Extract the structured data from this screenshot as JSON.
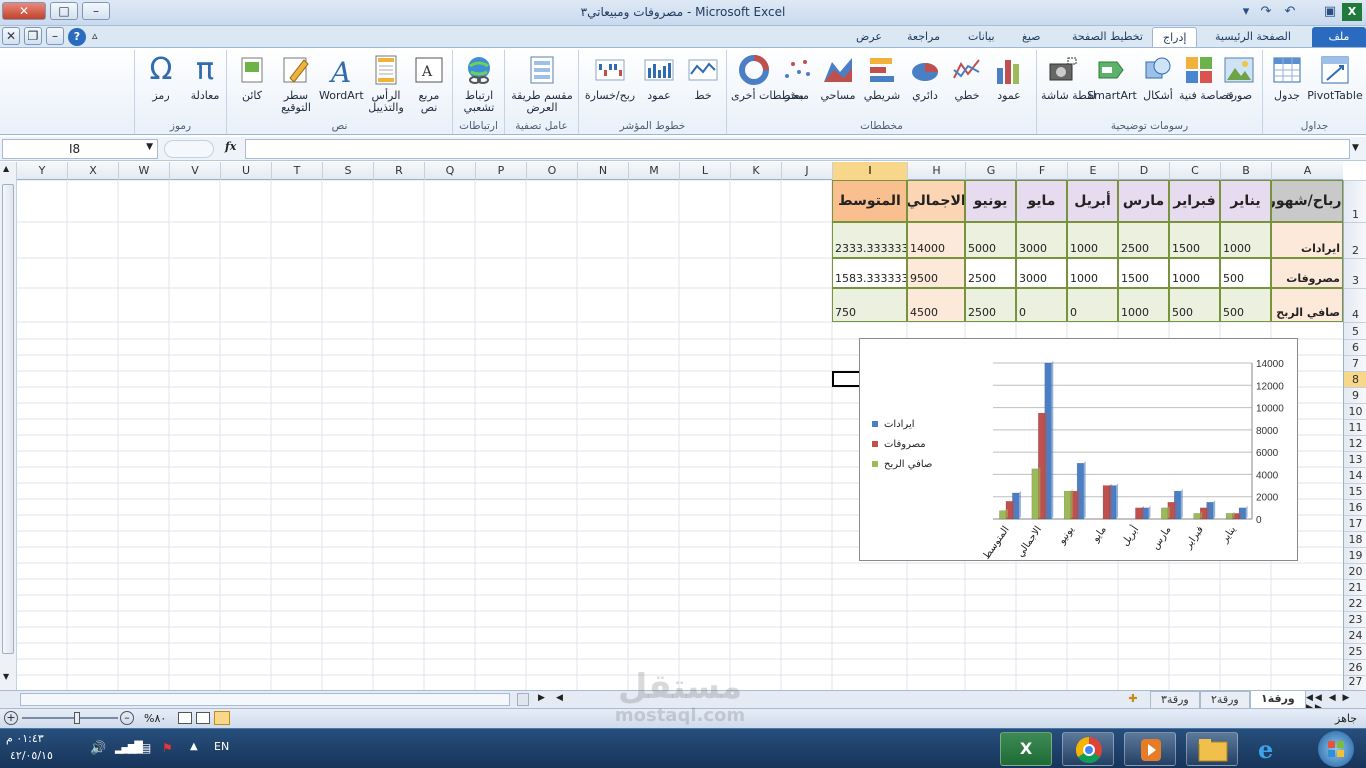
{
  "window": {
    "title": "مصروفات ومبيعاتي٣ - Microsoft Excel"
  },
  "qat": {
    "save_icon": "save-icon",
    "undo_icon": "undo-icon",
    "redo_icon": "redo-icon",
    "dropdown_icon": "chevron-down-icon"
  },
  "tabs": [
    {
      "label": "ملف",
      "name": "tab-file"
    },
    {
      "label": "الصفحة الرئيسية",
      "name": "tab-home"
    },
    {
      "label": "إدراج",
      "name": "tab-insert"
    },
    {
      "label": "تخطيط الصفحة",
      "name": "tab-page-layout"
    },
    {
      "label": "صيغ",
      "name": "tab-formulas"
    },
    {
      "label": "بيانات",
      "name": "tab-data"
    },
    {
      "label": "مراجعة",
      "name": "tab-review"
    },
    {
      "label": "عرض",
      "name": "tab-view"
    }
  ],
  "ribbon": {
    "groups": {
      "tables": "جداول",
      "illustrations": "رسومات توضيحية",
      "charts": "مخططات",
      "sparklines": "خطوط المؤشر",
      "filter": "عامل تصفية",
      "links": "ارتباطات",
      "text": "نص",
      "symbols": "رموز"
    },
    "buttons": {
      "pivot": "PivotTable",
      "table": "جدول",
      "picture": "صورة",
      "clipart": "قصاصة فنية",
      "shapes": "أشكال",
      "smartart": "SmartArt",
      "screenshot": "لقطة شاشة",
      "column": "عمود",
      "line": "خطي",
      "pie": "دائري",
      "bar": "شريطي",
      "area": "مساحي",
      "scatter": "مبعثر",
      "other": "مخططات أخرى",
      "sp_line": "خط",
      "sp_column": "عمود",
      "sp_winloss": "ربح/خسارة",
      "slicer": "مقسم طريقة العرض",
      "hyperlink": "ارتباط تشعبي",
      "textbox": "مربع نص",
      "headerfooter": "الرأس والتذييل",
      "wordart": "WordArt",
      "signature": "سطر التوقيع",
      "object": "كائن",
      "equation": "معادلة",
      "symbol": "رمز"
    }
  },
  "formula_bar": {
    "name_box": "I8",
    "fx": "fx",
    "formula": ""
  },
  "columns": [
    "A",
    "B",
    "C",
    "D",
    "E",
    "F",
    "G",
    "H",
    "I",
    "J",
    "K",
    "L",
    "M",
    "N",
    "O",
    "P",
    "Q",
    "R",
    "S",
    "T",
    "U",
    "V",
    "W",
    "X",
    "Y"
  ],
  "rows": [
    "1",
    "2",
    "3",
    "4",
    "5",
    "6",
    "7",
    "8",
    "9",
    "10",
    "11",
    "12",
    "13",
    "14",
    "15",
    "16",
    "17",
    "18",
    "19",
    "20",
    "21",
    "22",
    "23",
    "24",
    "25",
    "26",
    "27"
  ],
  "selected": {
    "column": "I",
    "row": "8"
  },
  "table": {
    "header": [
      "ارباح/شهور",
      "يناير",
      "فبراير",
      "مارس",
      "أبريل",
      "مايو",
      "يونيو",
      "الاجمالي",
      "المتوسط"
    ],
    "body": [
      [
        "ايرادات",
        "1000",
        "1500",
        "2500",
        "1000",
        "3000",
        "5000",
        "14000",
        "2333.333333"
      ],
      [
        "مصروفات",
        "500",
        "1000",
        "1500",
        "1000",
        "3000",
        "2500",
        "9500",
        "1583.333333"
      ],
      [
        "صافي الربح",
        "500",
        "500",
        "1000",
        "0",
        "0",
        "2500",
        "4500",
        "750"
      ]
    ]
  },
  "chart_data": {
    "type": "bar",
    "categories": [
      "يناير",
      "فبراير",
      "مارس",
      "أبريل",
      "مايو",
      "يونيو",
      "الاجمالي",
      "المتوسط"
    ],
    "series": [
      {
        "name": "ايرادات",
        "values": [
          1000,
          1500,
          2500,
          1000,
          3000,
          5000,
          14000,
          2333.333333
        ],
        "color": "#4a7fc6"
      },
      {
        "name": "مصروفات",
        "values": [
          500,
          1000,
          1500,
          1000,
          3000,
          2500,
          9500,
          1583.333333
        ],
        "color": "#c0504d"
      },
      {
        "name": "صافي الربح",
        "values": [
          500,
          500,
          1000,
          0,
          0,
          2500,
          4500,
          750
        ],
        "color": "#9bbb59"
      }
    ],
    "yticks": [
      "0",
      "2000",
      "4000",
      "6000",
      "8000",
      "10000",
      "12000",
      "14000"
    ],
    "ylim": [
      0,
      14000
    ],
    "axis_side": "right",
    "legend": "left",
    "grid": true
  },
  "sheets": [
    "ورقة١",
    "ورقة٢",
    "ورقة٣"
  ],
  "status": {
    "ready": "جاهز",
    "zoom": "%٨٠"
  },
  "taskbar": {
    "time": "٠١:٤٣ م",
    "date": "٤٢/٠٥/١٥",
    "lang": "EN"
  },
  "watermark": {
    "ar": "مستقل",
    "url": "mostaql.com"
  }
}
